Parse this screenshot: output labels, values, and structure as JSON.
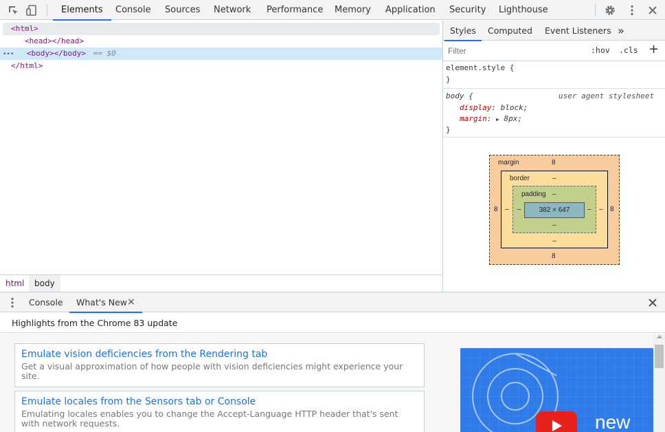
{
  "toolbar": {
    "tabs": [
      "Elements",
      "Console",
      "Sources",
      "Network",
      "Performance",
      "Memory",
      "Application",
      "Security",
      "Lighthouse"
    ],
    "icons": [
      "inspect-icon",
      "device-toggle-icon",
      "settings-icon",
      "more-icon",
      "close-icon"
    ]
  },
  "dom": {
    "html_open": "<html>",
    "head_line": "<head></head>",
    "body_line": "<body></body>",
    "body_suffix": "== $0",
    "html_close": "</html>",
    "ellipsis": "•••"
  },
  "breadcrumbs": [
    "html",
    "body"
  ],
  "styles": {
    "tabs": [
      "Styles",
      "Computed",
      "Event Listeners"
    ],
    "overflow": "»",
    "filter_placeholder": "Filter",
    "hov": ":hov",
    "cls": ".cls",
    "plus": "+",
    "element_style": "element.style {",
    "close_brace": "}",
    "body_selector": "body {",
    "ua_label": "user agent stylesheet",
    "rules": [
      {
        "prop": "display",
        "value": "block;"
      },
      {
        "prop": "margin",
        "value": "8px;"
      }
    ]
  },
  "box_model": {
    "margin_label": "margin",
    "border_label": "border",
    "padding_label": "padding",
    "margin_top": "8",
    "margin_bottom": "8",
    "margin_left": "8",
    "margin_right": "8",
    "border_top": "–",
    "border_bottom": "–",
    "border_left": "–",
    "border_right": "–",
    "padding_top": "–",
    "padding_bottom": "–",
    "padding_left": "–",
    "padding_right": "–",
    "content_size": "382 × 647",
    "colors": {
      "margin": "#f9cc9d",
      "border": "#fddd9b",
      "padding": "#c3d08b",
      "content": "#8cb6c0"
    }
  },
  "drawer": {
    "tabs": [
      "Console",
      "What's New"
    ],
    "close_tab": "×",
    "highlights": "Highlights from the Chrome 83 update",
    "cards": [
      {
        "title": "Emulate vision deficiencies from the Rendering tab",
        "desc": "Get a visual approximation of how people with vision deficiencies might experience your site."
      },
      {
        "title": "Emulate locales from the Sensors tab or Console",
        "desc": "Emulating locales enables you to change the Accept-Language HTTP header that's sent with network requests."
      }
    ],
    "promo_text": "new"
  }
}
